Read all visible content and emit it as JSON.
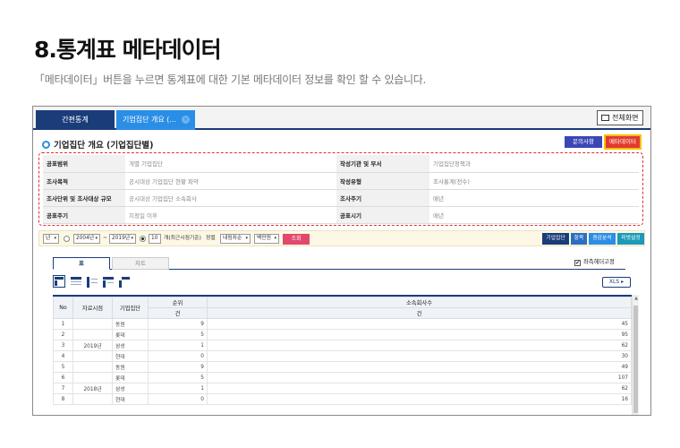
{
  "page": {
    "title": "8.통계표 메타데이터",
    "description": "「메타데이터」버튼을 누르면 통계표에 대한 기본 메타데이터 정보를 확인 할 수 있습니다."
  },
  "topbar": {
    "tabs": [
      {
        "label": "간편통계"
      },
      {
        "label": "기업집단 개요 (..."
      }
    ],
    "fullscreen_label": "전체화면"
  },
  "stat": {
    "title": "기업집단 개요 (기업집단별)",
    "contact_label": "문의사항",
    "metadata_label": "메타데이터"
  },
  "metadata": {
    "rows": [
      {
        "k1": "공표범위",
        "v1": "개별 기업집단",
        "k2": "작성기관 및 부서",
        "v2": "기업집단정책과"
      },
      {
        "k1": "조사목적",
        "v1": "공시대상 기업집단 현황 파악",
        "k2": "작성유형",
        "v2": "조사통계(전수)"
      },
      {
        "k1": "조사단위 및 조사대상 규모",
        "v1": "공시대상 기업집단 소속회사",
        "k2": "조사주기",
        "v2": "매년"
      },
      {
        "k1": "공표주기",
        "v1": "지정일 이후",
        "k2": "공표시기",
        "v2": "매년"
      }
    ]
  },
  "filter": {
    "period_unit": "년",
    "from_year": "2004년",
    "tilde": "~",
    "to_year": "2019년",
    "count_value": "10",
    "count_suffix": "개(최근시점기준)",
    "sort_label": "정렬",
    "sort_value": "내림차순",
    "unit_value": "백만원",
    "query_label": "조회",
    "right_buttons": [
      {
        "label": "기업집단",
        "color": "#1a3d7a"
      },
      {
        "label": "항목",
        "color": "#2b6fc2"
      },
      {
        "label": "증감분석",
        "color": "#2b8ee6"
      },
      {
        "label": "피벗설정",
        "color": "#1b9ab8"
      }
    ]
  },
  "view": {
    "tab_table": "표",
    "tab_chart": "차트",
    "freeze_label": "좌측헤더고정",
    "freeze_check": "✔",
    "xls_label": "XLS ▸"
  },
  "grid": {
    "h_no": "No",
    "h_date": "자료시점",
    "h_group": "기업집단",
    "h_rank": "순위",
    "h_rank_unit": "건",
    "h_count": "소속회사수",
    "h_count_unit": "건",
    "rows": [
      {
        "no": "1",
        "date": "",
        "group": "동원",
        "rank": "9",
        "count": "45"
      },
      {
        "no": "2",
        "date": "",
        "group": "롯데",
        "rank": "5",
        "count": "95"
      },
      {
        "no": "3",
        "date": "2019년",
        "group": "삼성",
        "rank": "1",
        "count": "62"
      },
      {
        "no": "4",
        "date": "",
        "group": "현대",
        "rank": "0",
        "count": "30"
      },
      {
        "no": "5",
        "date": "",
        "group": "동원",
        "rank": "9",
        "count": "49"
      },
      {
        "no": "6",
        "date": "",
        "group": "롯데",
        "rank": "5",
        "count": "107"
      },
      {
        "no": "7",
        "date": "2018년",
        "group": "삼성",
        "rank": "1",
        "count": "62"
      },
      {
        "no": "8",
        "date": "",
        "group": "현대",
        "rank": "0",
        "count": "16"
      }
    ]
  },
  "colors": {
    "navy": "#1a3d7a",
    "active_tab": "#2b8ee6",
    "metadata_button": "#e23a2e",
    "highlight_border": "#f2c200",
    "query_button": "#e2486c"
  }
}
